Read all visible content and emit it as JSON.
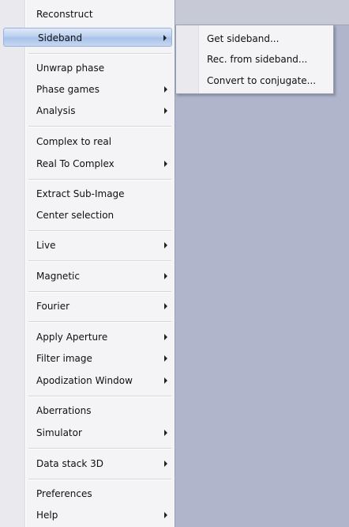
{
  "menu": {
    "items": [
      {
        "label": "Reconstruct"
      },
      {
        "label": "Sideband"
      },
      {
        "label": "Unwrap phase"
      },
      {
        "label": "Phase games"
      },
      {
        "label": "Analysis"
      },
      {
        "label": "Complex to real"
      },
      {
        "label": "Real To Complex"
      },
      {
        "label": "Extract Sub-Image"
      },
      {
        "label": "Center selection"
      },
      {
        "label": "Live"
      },
      {
        "label": "Magnetic"
      },
      {
        "label": "Fourier"
      },
      {
        "label": "Apply Aperture"
      },
      {
        "label": "Filter image"
      },
      {
        "label": "Apodization Window"
      },
      {
        "label": "Aberrations"
      },
      {
        "label": "Simulator"
      },
      {
        "label": "Data stack 3D"
      },
      {
        "label": "Preferences"
      },
      {
        "label": "Help"
      }
    ]
  },
  "submenu": {
    "items": [
      {
        "label": "Get sideband..."
      },
      {
        "label": "Rec. from sideband..."
      },
      {
        "label": "Convert to conjugate..."
      }
    ]
  }
}
